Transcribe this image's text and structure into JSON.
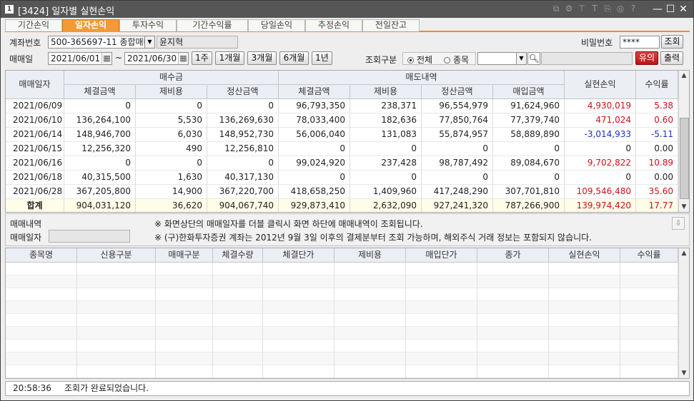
{
  "window": {
    "app_icon": "1",
    "title": "[3424] 일자별 실현손익",
    "toolbar_icons": [
      "link-icon",
      "settings-icon",
      "pin-icon",
      "font-icon",
      "copy-icon",
      "camera-icon",
      "help-icon"
    ],
    "toolbar_glyphs": [
      "⧉",
      "⚙",
      "⊤",
      "T",
      "⎘",
      "◎",
      "?"
    ],
    "minimize": "—",
    "maximize": "☐",
    "close": "✕"
  },
  "tabs": [
    "기간손익",
    "일자손익",
    "투자수익",
    "기간수익률",
    "당일손익",
    "추정손익",
    "전일잔고"
  ],
  "active_tab": 1,
  "form": {
    "account_label": "계좌번호",
    "account_value": "500-365697-11 종합매매",
    "account_owner": "윤지혁",
    "trade_label": "매매일",
    "date_from": "2021/06/01",
    "date_to": "2021/06/30",
    "tilde": "~",
    "period_buttons": [
      "1주",
      "1개월",
      "3개월",
      "6개월",
      "1년"
    ],
    "password_label": "비밀번호",
    "password_value": "****",
    "query_button": "조회",
    "search_type_label": "조회구분",
    "radio_all": "전체",
    "radio_item": "종목",
    "notice_button": "유의",
    "print_button": "출력"
  },
  "upper_table": {
    "col_date": "매매일자",
    "group_buy": "매수금",
    "group_sell": "매도내역",
    "col_realized": "실현손익",
    "col_rate": "수익률",
    "buy_cols": [
      "체결금액",
      "제비용",
      "정산금액"
    ],
    "sell_cols": [
      "체결금액",
      "제비용",
      "정산금액",
      "매입금액"
    ],
    "rows": [
      {
        "date": "2021/06/09",
        "buy_exec": "0",
        "buy_fee": "0",
        "buy_settle": "0",
        "sell_exec": "96,793,350",
        "sell_fee": "238,371",
        "sell_settle": "96,554,979",
        "sell_cost": "91,624,960",
        "pnl": "4,930,019",
        "rate": "5.38",
        "sign": "pos"
      },
      {
        "date": "2021/06/10",
        "buy_exec": "136,264,100",
        "buy_fee": "5,530",
        "buy_settle": "136,269,630",
        "sell_exec": "78,033,400",
        "sell_fee": "182,636",
        "sell_settle": "77,850,764",
        "sell_cost": "77,379,740",
        "pnl": "471,024",
        "rate": "0.60",
        "sign": "pos"
      },
      {
        "date": "2021/06/14",
        "buy_exec": "148,946,700",
        "buy_fee": "6,030",
        "buy_settle": "148,952,730",
        "sell_exec": "56,006,040",
        "sell_fee": "131,083",
        "sell_settle": "55,874,957",
        "sell_cost": "58,889,890",
        "pnl": "-3,014,933",
        "rate": "-5.11",
        "sign": "neg"
      },
      {
        "date": "2021/06/15",
        "buy_exec": "12,256,320",
        "buy_fee": "490",
        "buy_settle": "12,256,810",
        "sell_exec": "0",
        "sell_fee": "0",
        "sell_settle": "0",
        "sell_cost": "0",
        "pnl": "0",
        "rate": "0.00",
        "sign": "zero"
      },
      {
        "date": "2021/06/16",
        "buy_exec": "0",
        "buy_fee": "0",
        "buy_settle": "0",
        "sell_exec": "99,024,920",
        "sell_fee": "237,428",
        "sell_settle": "98,787,492",
        "sell_cost": "89,084,670",
        "pnl": "9,702,822",
        "rate": "10.89",
        "sign": "pos"
      },
      {
        "date": "2021/06/18",
        "buy_exec": "40,315,500",
        "buy_fee": "1,630",
        "buy_settle": "40,317,130",
        "sell_exec": "0",
        "sell_fee": "0",
        "sell_settle": "0",
        "sell_cost": "0",
        "pnl": "0",
        "rate": "0.00",
        "sign": "zero"
      },
      {
        "date": "2021/06/28",
        "buy_exec": "367,205,800",
        "buy_fee": "14,900",
        "buy_settle": "367,220,700",
        "sell_exec": "418,658,250",
        "sell_fee": "1,409,960",
        "sell_settle": "417,248,290",
        "sell_cost": "307,701,810",
        "pnl": "109,546,480",
        "rate": "35.60",
        "sign": "pos"
      }
    ],
    "total": {
      "date": "합계",
      "buy_exec": "904,031,120",
      "buy_fee": "36,620",
      "buy_settle": "904,067,740",
      "sell_exec": "929,873,410",
      "sell_fee": "2,632,090",
      "sell_settle": "927,241,320",
      "sell_cost": "787,266,900",
      "pnl": "139,974,420",
      "rate": "17.77",
      "sign": "pos"
    }
  },
  "mid_panel": {
    "label_trades": "매매내역",
    "label_date": "매매일자",
    "note1": "※ 화면상단의 매매일자를 더블 클릭시 화면 하단에 매매내역이 조회됩니다.",
    "note2": "※ (구)한화투자증권 계좌는 2012년 9월 3일 이후의 결제분부터 조회 가능하며, 해외주식 거래 정보는 포함되지 않습니다."
  },
  "lower_table": {
    "cols": [
      "종목명",
      "신용구분",
      "매매구분",
      "체결수량",
      "체결단가",
      "제비용",
      "매입단가",
      "종가",
      "실현손익",
      "수익률"
    ]
  },
  "status": {
    "time": "20:58:36",
    "message": "조회가 완료되었습니다."
  },
  "colors": {
    "title_bar": "#565656",
    "active_tab": "#f29a38",
    "positive": "#d0101b",
    "negative": "#1b2fc4"
  }
}
